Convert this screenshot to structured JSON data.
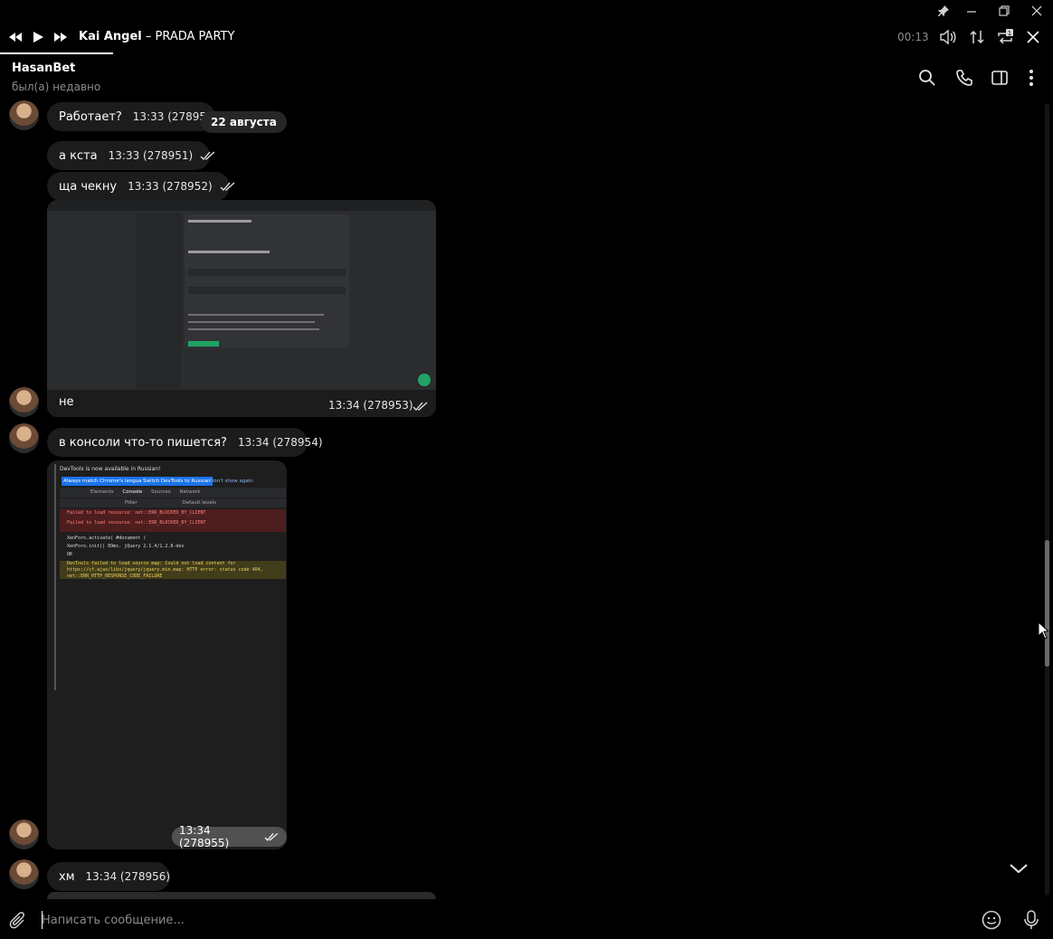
{
  "player": {
    "artist": "Kai Angel",
    "separator": " – ",
    "track": "PRADA PARTY",
    "time": "00:13",
    "progress_fraction": 0.11
  },
  "chat": {
    "name": "HasanBet",
    "status": "был(а) недавно"
  },
  "date_separator": "22 августа",
  "messages": [
    {
      "text": "Работает?",
      "time": "13:33 (278950)"
    },
    {
      "text": "а кста",
      "time": "13:33 (278951)"
    },
    {
      "text": "ща чекну",
      "time": "13:33 (278952)"
    },
    {
      "text": "не",
      "time": "13:34 (278953)"
    },
    {
      "text": "в консоли что-то пишется?",
      "time": "13:34 (278954)"
    },
    {
      "text": "",
      "time": "13:34 (278955)"
    },
    {
      "text": "хм",
      "time": "13:34 (278956)"
    }
  ],
  "screenshot_preview": {
    "banner": "DevTools is now available in Russian!",
    "btn_always": "Always match Chrome's language",
    "btn_switch": "Switch DevTools to Russian",
    "btn_dont": "Don't show again",
    "tabs": [
      "Elements",
      "Console",
      "Sources",
      "Network"
    ],
    "filter": "Filter",
    "levels": "Default levels",
    "err1": "Failed to load resource: net::ERR_BLOCKED_BY_CLIENT",
    "err2": "Failed to load resource: net::ERR_BLOCKED_BY_CLIENT",
    "log1": "XenForo.activate( #document )",
    "log2": "XenForo.init() 89ms. jQuery 2.1.4/1.2.8-dev",
    "log3": "OK",
    "warn": "DevTools failed to load source map: Could not load content for https://cf.ajax/libs/jquery/jquery.min.map: HTTP error: status code 404, net::ERR_HTTP_RESPONSE_CODE_FAILURE"
  },
  "input": {
    "placeholder": "Написать сообщение..."
  },
  "colors": {
    "background": "#000000",
    "bubble": "#1c1c1d",
    "accent_green": "#21a366"
  }
}
